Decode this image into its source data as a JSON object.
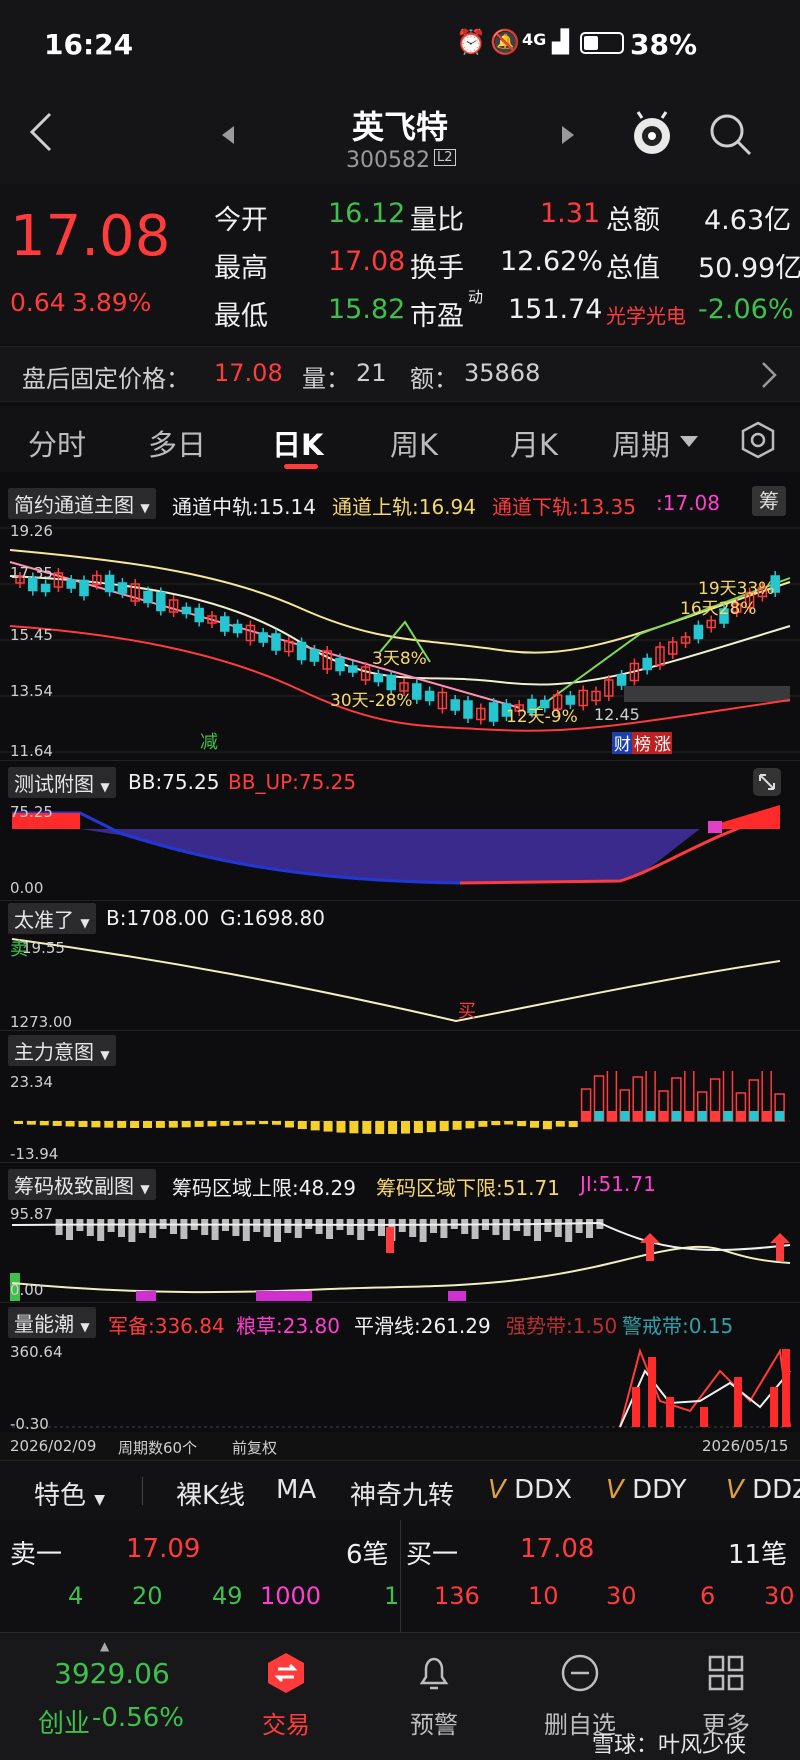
{
  "status": {
    "time": "16:24",
    "network": "4G",
    "battery": "38%"
  },
  "title": {
    "name": "英飞特",
    "code": "300582",
    "code_badge": "L2"
  },
  "quote": {
    "price": "17.08",
    "change": "0.64",
    "change_pct": "3.89%",
    "rows": [
      {
        "l1": "今开",
        "v1": "16.12",
        "l2": "量比",
        "v2": "1.31",
        "l3": "总额",
        "v3": "4.63亿"
      },
      {
        "l1": "最高",
        "v1": "17.08",
        "l2": "换手",
        "v2": "12.62%",
        "l3": "总值",
        "v3": "50.99亿"
      },
      {
        "l1": "最低",
        "v1": "15.82",
        "l2": "市盈",
        "l2sup": "动",
        "v2": "151.74",
        "l3": "光学光电",
        "v3": "-2.06%"
      }
    ]
  },
  "afterhours": {
    "label": "盘后固定价格：",
    "price": "17.08",
    "vol_label": "量：",
    "vol": "21",
    "amt_label": "额：",
    "amt": "35868"
  },
  "tabs": [
    "分时",
    "多日",
    "日K",
    "周K",
    "月K",
    "周期"
  ],
  "active_tab": "日K",
  "main_chart": {
    "indicator": "简约通道主图",
    "mid": "通道中轨:15.14",
    "up": "通道上轨:16.94",
    "down": "通道下轨:13.35",
    "last": ":17.08",
    "side_btn": "筹",
    "y_labels": [
      "19.26",
      "17.35",
      "15.45",
      "13.54",
      "11.64"
    ],
    "annotations": {
      "a1": "19天33%",
      "a2": "16天28%",
      "a3": "3天8%",
      "a4": "30天-28%",
      "a5": "12天-9%",
      "low": "12.45",
      "reduce": "减",
      "tag1": "财",
      "tag2": "榜",
      "tag3": "涨"
    }
  },
  "bb_panel": {
    "indicator": "测试附图",
    "bb": "BB:75.25",
    "bb_up": "BB_UP:75.25",
    "y_top": "75.25",
    "y_bot": "0.00"
  },
  "tzl_panel": {
    "indicator": "太准了",
    "b": "B:1708.00",
    "g": "G:1698.80",
    "y_top": "19.55",
    "y_bot": "1273.00",
    "sell": "卖",
    "buy": "买"
  },
  "zl_panel": {
    "indicator": "主力意图",
    "y_top": "23.34",
    "y_bot": "-13.94"
  },
  "cm_panel": {
    "indicator": "筹码极致副图",
    "upper": "筹码区域上限:48.29",
    "lower": "筹码区域下限:51.71",
    "ji": "JI:51.71",
    "y_top": "95.87",
    "y_bot": "0.00"
  },
  "lnc_panel": {
    "indicator": "量能潮",
    "jb": "军备:336.84",
    "lc": "粮草:23.80",
    "ph": "平滑线:261.29",
    "qs": "强势带:1.50",
    "jj": "警戒带:0.15",
    "y_top": "360.64",
    "y_bot": "-0.30"
  },
  "date_bar": {
    "start": "2026/02/09",
    "count": "周期数60个",
    "adj": "前复权",
    "end": "2026/05/15"
  },
  "tools": [
    "特色",
    "裸K线",
    "MA",
    "神奇九转",
    "DDX",
    "DDY",
    "DDZ"
  ],
  "orderbook": {
    "sell_label": "卖一",
    "sell_price": "17.09",
    "sell_count": "6笔",
    "buy_label": "买一",
    "buy_price": "17.08",
    "buy_count": "11笔",
    "sell_row": [
      "4",
      "20",
      "49",
      "1000",
      "1"
    ],
    "buy_row": [
      "136",
      "10",
      "30",
      "6",
      "30"
    ]
  },
  "nav": {
    "index_value": "3929.06",
    "index_name": "创业",
    "index_change": "-0.56%",
    "items": [
      "交易",
      "预警",
      "删自选",
      "更多"
    ],
    "watermark": "雪球：叶风少侠"
  },
  "colors": {
    "up": "#ff3b3b",
    "down": "#3ec04d",
    "bg": "#0d0d0f",
    "bull_candle": "#ff3b3b",
    "bear_candle": "#26c6d0"
  }
}
